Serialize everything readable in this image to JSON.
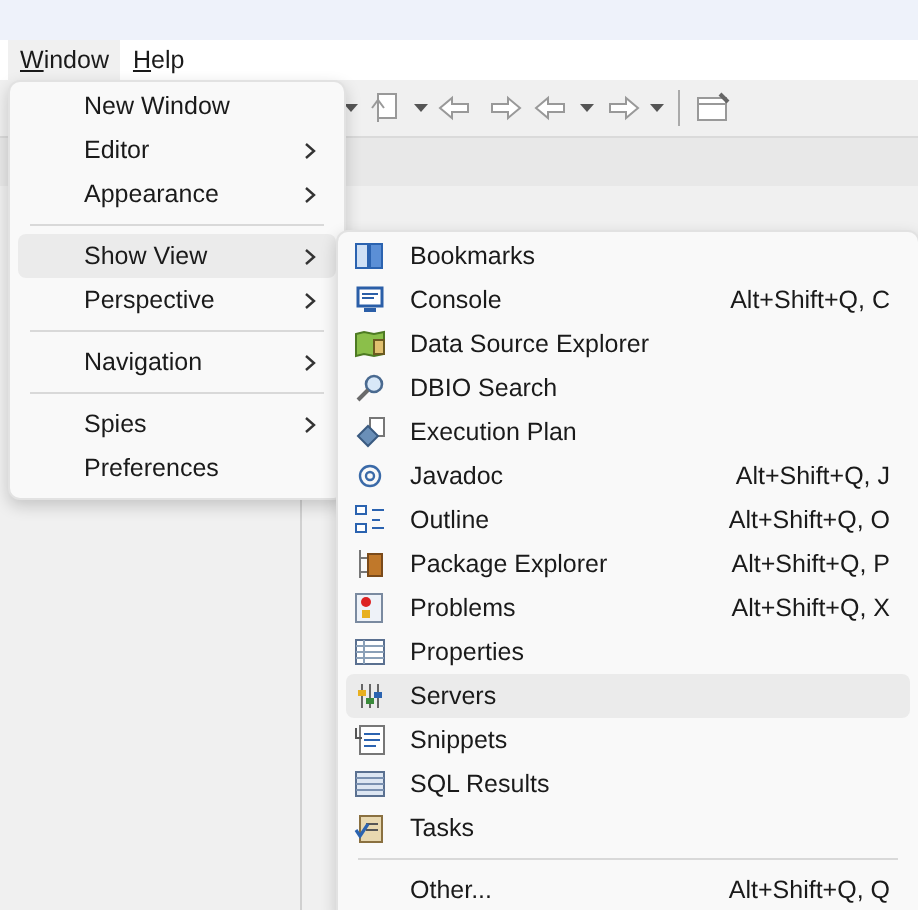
{
  "menubar": [
    {
      "label": "Window",
      "selected": true
    },
    {
      "label": "Help",
      "selected": false
    }
  ],
  "window_menu": [
    {
      "kind": "item",
      "label": "New Window",
      "submenu": false,
      "selected": false
    },
    {
      "kind": "item",
      "label": "Editor",
      "submenu": true,
      "selected": false
    },
    {
      "kind": "item",
      "label": "Appearance",
      "submenu": true,
      "selected": false
    },
    {
      "kind": "separator"
    },
    {
      "kind": "item",
      "label": "Show View",
      "submenu": true,
      "selected": true
    },
    {
      "kind": "item",
      "label": "Perspective",
      "submenu": true,
      "selected": false
    },
    {
      "kind": "separator"
    },
    {
      "kind": "item",
      "label": "Navigation",
      "submenu": true,
      "selected": false
    },
    {
      "kind": "separator"
    },
    {
      "kind": "item",
      "label": "Spies",
      "submenu": true,
      "selected": false
    },
    {
      "kind": "item",
      "label": "Preferences",
      "submenu": false,
      "selected": false
    }
  ],
  "show_view_menu": [
    {
      "kind": "item",
      "label": "Bookmarks",
      "selected": false
    },
    {
      "kind": "item",
      "label": "Console",
      "shortcut": "Alt+Shift+Q, C",
      "selected": false
    },
    {
      "kind": "item",
      "label": "Data Source Explorer",
      "selected": false
    },
    {
      "kind": "item",
      "label": "DBIO Search",
      "selected": false
    },
    {
      "kind": "item",
      "label": "Execution Plan",
      "selected": false
    },
    {
      "kind": "item",
      "label": "Javadoc",
      "shortcut": "Alt+Shift+Q, J",
      "selected": false
    },
    {
      "kind": "item",
      "label": "Outline",
      "shortcut": "Alt+Shift+Q, O",
      "selected": false
    },
    {
      "kind": "item",
      "label": "Package Explorer",
      "shortcut": "Alt+Shift+Q, P",
      "selected": false
    },
    {
      "kind": "item",
      "label": "Problems",
      "shortcut": "Alt+Shift+Q, X",
      "selected": false
    },
    {
      "kind": "item",
      "label": "Properties",
      "selected": false
    },
    {
      "kind": "item",
      "label": "Servers",
      "selected": true
    },
    {
      "kind": "item",
      "label": "Snippets",
      "selected": false
    },
    {
      "kind": "item",
      "label": "SQL Results",
      "selected": false
    },
    {
      "kind": "item",
      "label": "Tasks",
      "selected": false
    },
    {
      "kind": "separator"
    },
    {
      "kind": "item",
      "label": "Other...",
      "shortcut": "Alt+Shift+Q, Q",
      "selected": false
    }
  ]
}
